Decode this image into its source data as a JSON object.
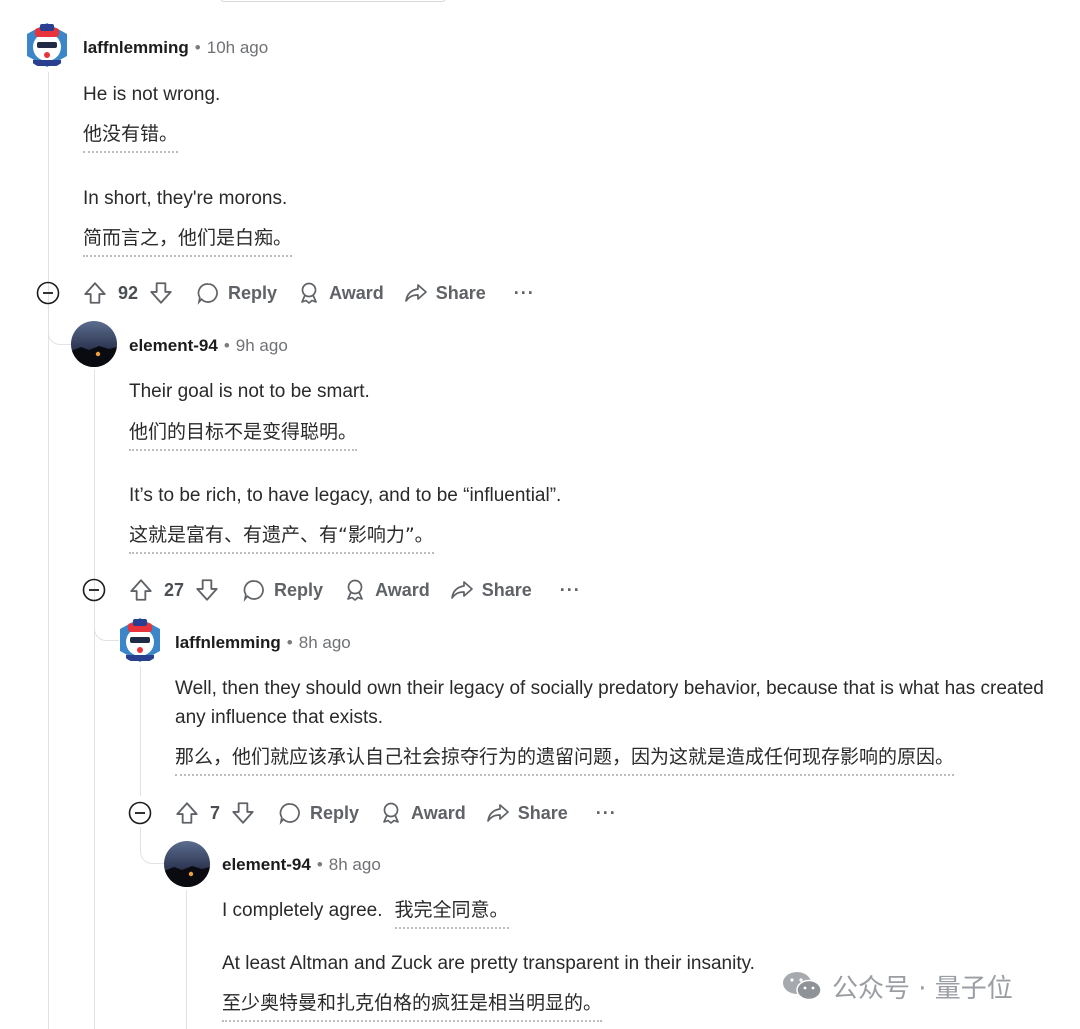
{
  "comments": [
    {
      "user": "laffnlemming",
      "dot": "•",
      "time": "10h ago",
      "body": [
        "He is not wrong.",
        "In short, they're morons."
      ],
      "translations": [
        "他没有错。",
        "简而言之，他们是白痴。"
      ],
      "votes": "92"
    },
    {
      "user": "element-94",
      "dot": "•",
      "time": "9h ago",
      "body": [
        "Their goal is not to be smart.",
        "It’s to be rich, to have legacy, and to be “influential”."
      ],
      "translations": [
        "他们的目标不是变得聪明。",
        "这就是富有、有遗产、有“影响力”。"
      ],
      "votes": "27"
    },
    {
      "user": "laffnlemming",
      "dot": "•",
      "time": "8h ago",
      "body": [
        "Well, then they should own their legacy of socially predatory behavior, because that is what has created any influence that exists."
      ],
      "translations": [
        "那么，他们就应该承认自己社会掠夺行为的遗留问题，因为这就是造成任何现存影响的原因。"
      ],
      "votes": "7"
    },
    {
      "user": "element-94",
      "dot": "•",
      "time": "8h ago",
      "body": [
        "I completely agree.",
        "At least Altman and Zuck are pretty transparent in their insanity."
      ],
      "translations": [
        "我完全同意。",
        "至少奥特曼和扎克伯格的疯狂是相当明显的。"
      ]
    }
  ],
  "actions": {
    "reply": "Reply",
    "award": "Award",
    "share": "Share",
    "more": "···"
  },
  "icons": [
    "collapse-icon",
    "upvote-icon",
    "downvote-icon",
    "reply-icon",
    "award-icon",
    "share-icon"
  ],
  "watermark": {
    "text": "公众号 · 量子位",
    "icon": "wechat-icon"
  },
  "colors": {
    "text": "#1c1c1c",
    "muted": "#5f6266",
    "thread": "#dfe3e6"
  }
}
